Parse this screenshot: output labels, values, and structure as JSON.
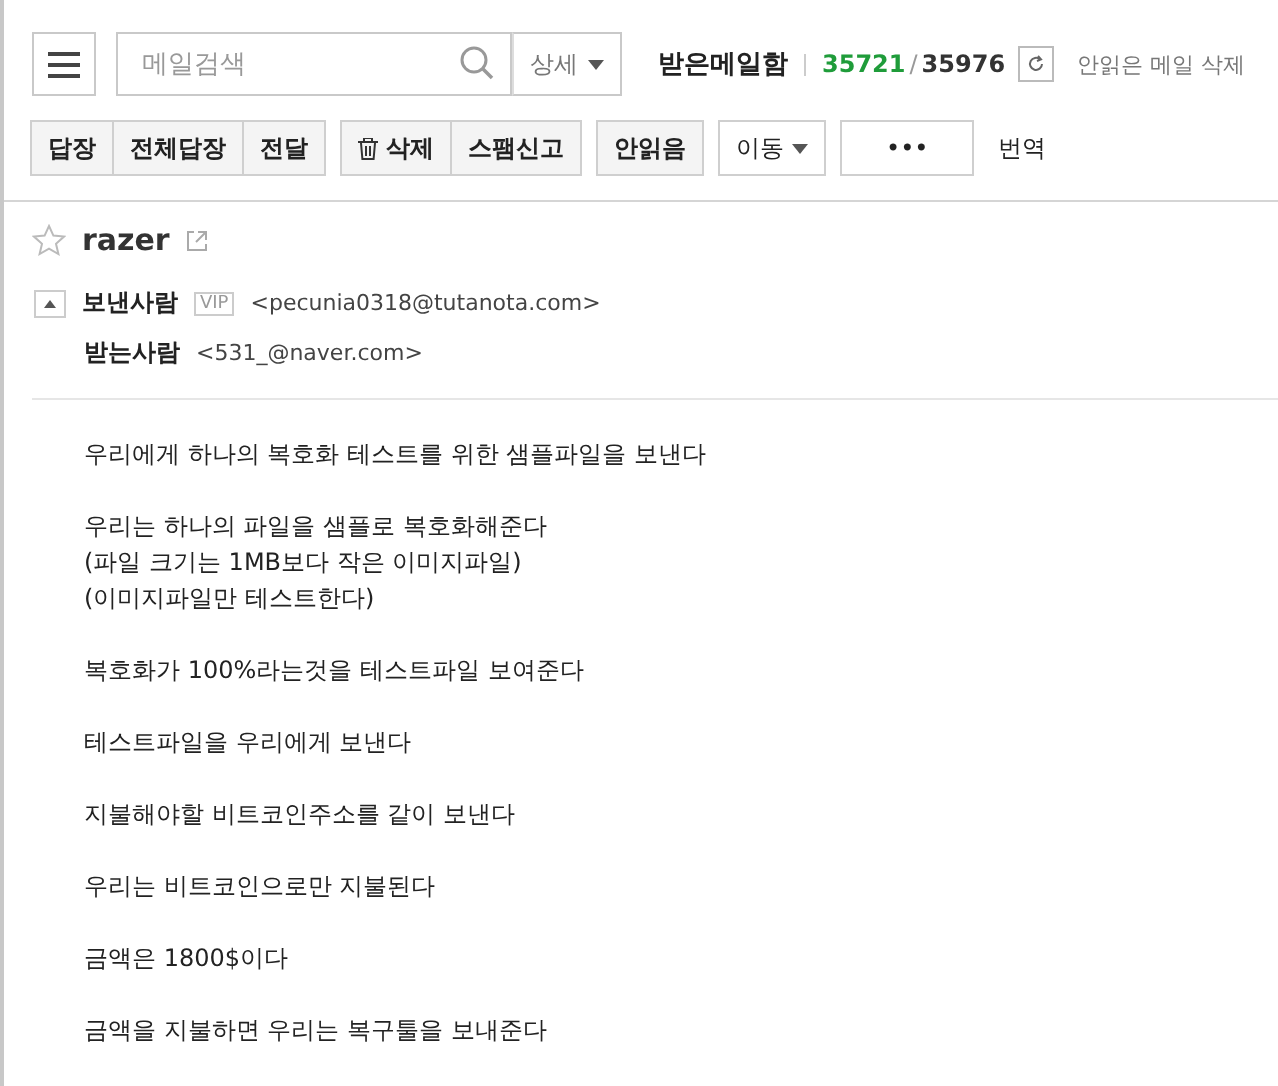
{
  "header": {
    "search": {
      "placeholder": "메일검색"
    },
    "detail_button": "상세",
    "mailbox": "받은메일함",
    "unread_count": "35721",
    "separator": "/",
    "total_count": "35976",
    "delete_unread": "안읽은 메일 삭제"
  },
  "toolbar": {
    "groups": [
      {
        "buttons": [
          {
            "label": "답장",
            "kind": "plain"
          },
          {
            "label": "전체답장",
            "kind": "plain"
          },
          {
            "label": "전달",
            "kind": "plain"
          }
        ]
      },
      {
        "buttons": [
          {
            "label": "삭제",
            "kind": "trash"
          },
          {
            "label": "스팸신고",
            "kind": "plain"
          }
        ]
      },
      {
        "buttons": [
          {
            "label": "안읽음",
            "kind": "plain"
          }
        ]
      },
      {
        "buttons": [
          {
            "label": "이동",
            "kind": "dropdown"
          }
        ]
      },
      {
        "buttons": [
          {
            "label": "•••",
            "kind": "more"
          }
        ]
      }
    ],
    "translate": "번역"
  },
  "message": {
    "subject": "razer",
    "starred": false,
    "expanded": true,
    "sender": {
      "label": "보낸사람",
      "badge": "VIP",
      "address": "<pecunia0318@tutanota.com>"
    },
    "recipient": {
      "label": "받는사람",
      "address": "<531_@naver.com>"
    },
    "body": [
      {
        "lines": [
          "우리에게 하나의 복호화 테스트를 위한 샘플파일을 보낸다"
        ]
      },
      {
        "lines": [
          "우리는 하나의 파일을 샘플로 복호화해준다",
          "(파일 크기는 1MB보다 작은 이미지파일)",
          "(이미지파일만 테스트한다)"
        ]
      },
      {
        "lines": [
          "복호화가 100%라는것을 테스트파일 보여준다"
        ]
      },
      {
        "lines": [
          "테스트파일을 우리에게 보낸다"
        ]
      },
      {
        "lines": [
          "지불해야할 비트코인주소를 같이 보낸다"
        ]
      },
      {
        "lines": [
          "우리는 비트코인으로만 지불된다"
        ]
      },
      {
        "lines": [
          "금액은 1800$이다"
        ]
      },
      {
        "lines": [
          "금액을 지불하면 우리는 복구툴을 보내준다"
        ]
      }
    ]
  }
}
